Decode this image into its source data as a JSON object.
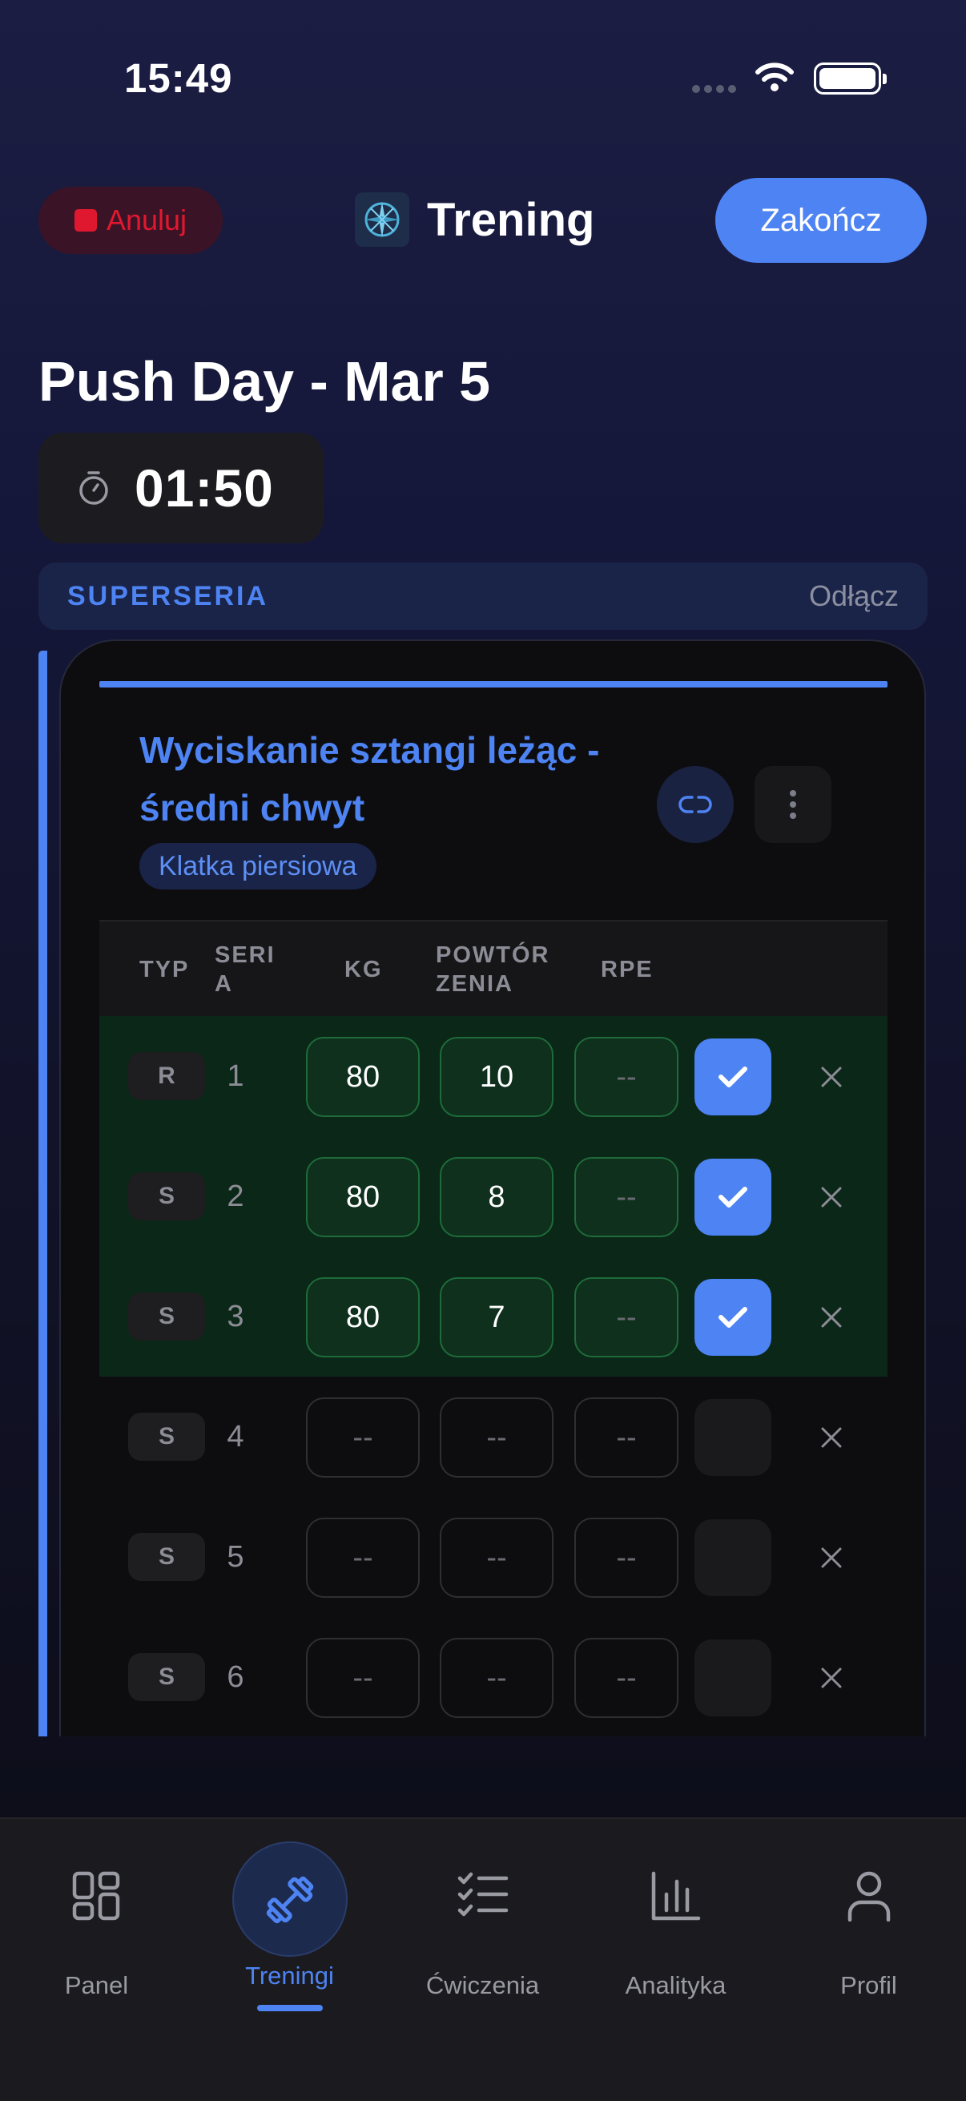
{
  "status_bar": {
    "time": "15:49"
  },
  "header": {
    "cancel_label": "Anuluj",
    "title": "Trening",
    "finish_label": "Zakończ"
  },
  "workout": {
    "name": "Push Day - Mar 5",
    "elapsed": "01:50"
  },
  "superset": {
    "label": "SUPERSERIA",
    "unlink_label": "Odłącz"
  },
  "exercise": {
    "name": "Wyciskanie sztangi leżąc - średni chwyt",
    "muscle": "Klatka piersiowa",
    "columns": {
      "type": "TYP",
      "set_line1": "SERI",
      "set_line2": "A",
      "kg": "KG",
      "reps_line1": "POWTÓR",
      "reps_line2": "ZENIA",
      "rpe": "RPE"
    },
    "sets": [
      {
        "type": "R",
        "num": "1",
        "kg": "80",
        "reps": "10",
        "rpe": "--",
        "done": true
      },
      {
        "type": "S",
        "num": "2",
        "kg": "80",
        "reps": "8",
        "rpe": "--",
        "done": true
      },
      {
        "type": "S",
        "num": "3",
        "kg": "80",
        "reps": "7",
        "rpe": "--",
        "done": true
      },
      {
        "type": "S",
        "num": "4",
        "kg": "--",
        "reps": "--",
        "rpe": "--",
        "done": false
      },
      {
        "type": "S",
        "num": "5",
        "kg": "--",
        "reps": "--",
        "rpe": "--",
        "done": false
      },
      {
        "type": "S",
        "num": "6",
        "kg": "--",
        "reps": "--",
        "rpe": "--",
        "done": false
      }
    ]
  },
  "tabs": [
    {
      "label": "Panel",
      "icon": "grid-icon",
      "active": false
    },
    {
      "label": "Treningi",
      "icon": "dumbbell-icon",
      "active": true
    },
    {
      "label": "Ćwiczenia",
      "icon": "checklist-icon",
      "active": false
    },
    {
      "label": "Analityka",
      "icon": "bar-chart-icon",
      "active": false
    },
    {
      "label": "Profil",
      "icon": "person-icon",
      "active": false
    }
  ],
  "colors": {
    "accent": "#4d83f2",
    "danger": "#e0182f",
    "done_row": "#0b2718",
    "done_border": "#1f6b3a"
  }
}
